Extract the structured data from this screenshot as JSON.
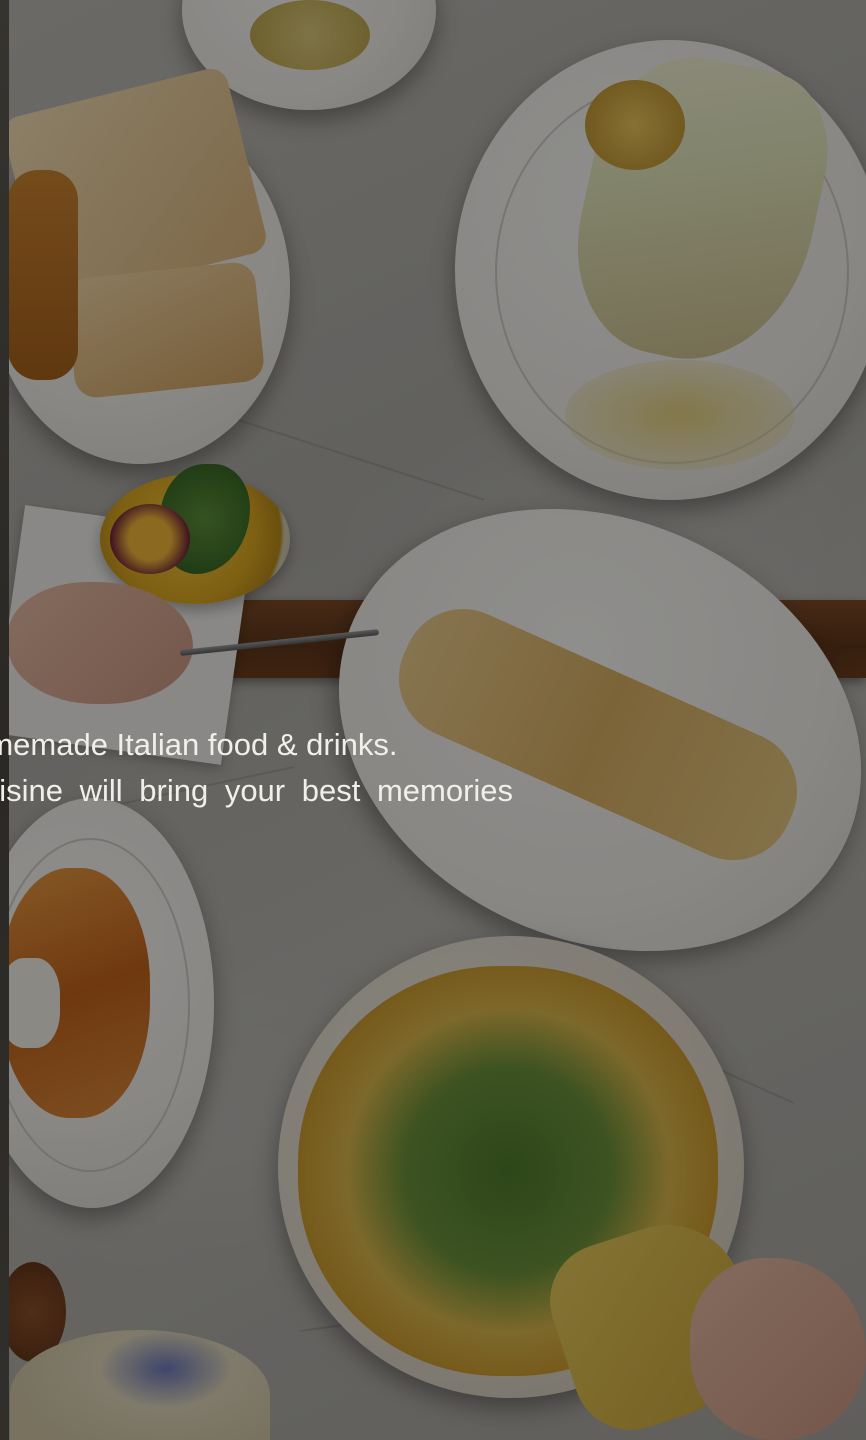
{
  "hero": {
    "tagline_line1": "ntic homemade Italian food & drinks.",
    "tagline_line2": "uisine will bring your best memories"
  },
  "colors": {
    "overlay": "rgba(0,0,0,0.42)",
    "tagline_text": "#f1efea",
    "marble": "#b3b1ac",
    "wood_board": "#6b3d1e"
  }
}
